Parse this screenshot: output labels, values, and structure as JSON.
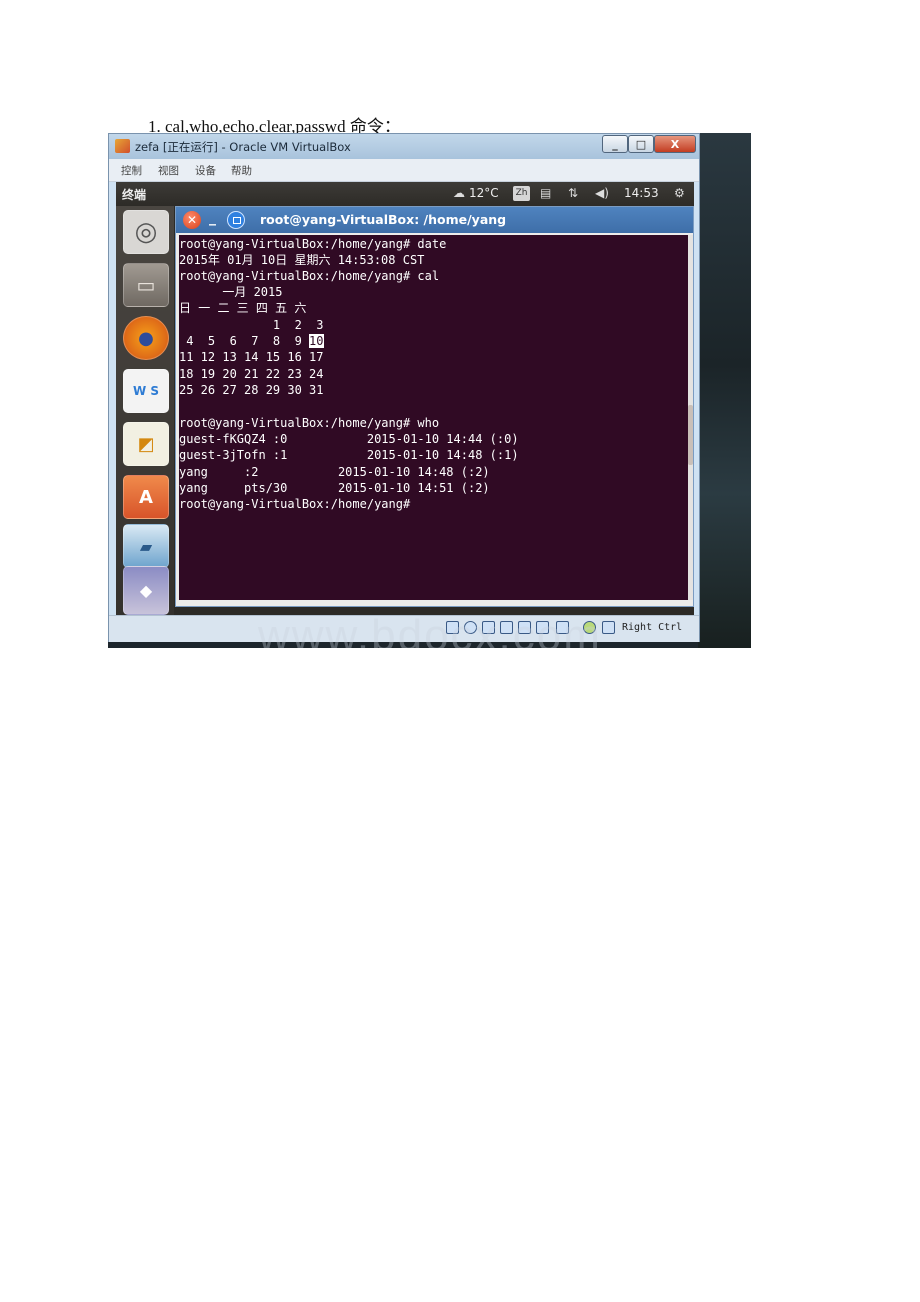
{
  "document": {
    "heading": "1. cal,who,echo.clear,passwd 命令："
  },
  "vbox": {
    "title": "zefa [正在运行] - Oracle VM VirtualBox",
    "buttons": {
      "minimize": "_",
      "maximize": "□",
      "close": "X"
    },
    "menu": [
      "控制",
      "视图",
      "设备",
      "帮助"
    ],
    "status_host_key": "Right Ctrl"
  },
  "ubuntu_top_panel": {
    "app_name": "终端",
    "weather": "12°C",
    "input_method": "Zh",
    "clock": "14:53"
  },
  "terminal": {
    "title": "root@yang-VirtualBox: /home/yang",
    "lines": [
      "root@yang-VirtualBox:/home/yang# date",
      "2015年 01月 10日 星期六 14:53:08 CST",
      "root@yang-VirtualBox:/home/yang# cal",
      "      一月 2015",
      "日 一 二 三 四 五 六",
      "             1  2  3",
      " 4  5  6  7  8  9 10",
      "11 12 13 14 15 16 17",
      "18 19 20 21 22 23 24",
      "25 26 27 28 29 30 31",
      "",
      "root@yang-VirtualBox:/home/yang# who",
      "guest-fKGQZ4 :0           2015-01-10 14:44 (:0)",
      "guest-3jTofn :1           2015-01-10 14:48 (:1)",
      "yang     :2           2015-01-10 14:48 (:2)",
      "yang     pts/30       2015-01-10 14:51 (:2)",
      "root@yang-VirtualBox:/home/yang#"
    ],
    "cal_week_prefix": " 4  5  6  7  8  9 ",
    "today": "10"
  },
  "launcher_items": [
    "ubuntu-dash",
    "files",
    "firefox",
    "office-suite",
    "impress",
    "software-center",
    "scanner",
    "more-apps"
  ],
  "colors": {
    "terminal_bg": "#300a24",
    "terminal_fg": "#ffffff",
    "titlebar": "#4a7db8"
  },
  "watermark": "www.bdocx.com"
}
